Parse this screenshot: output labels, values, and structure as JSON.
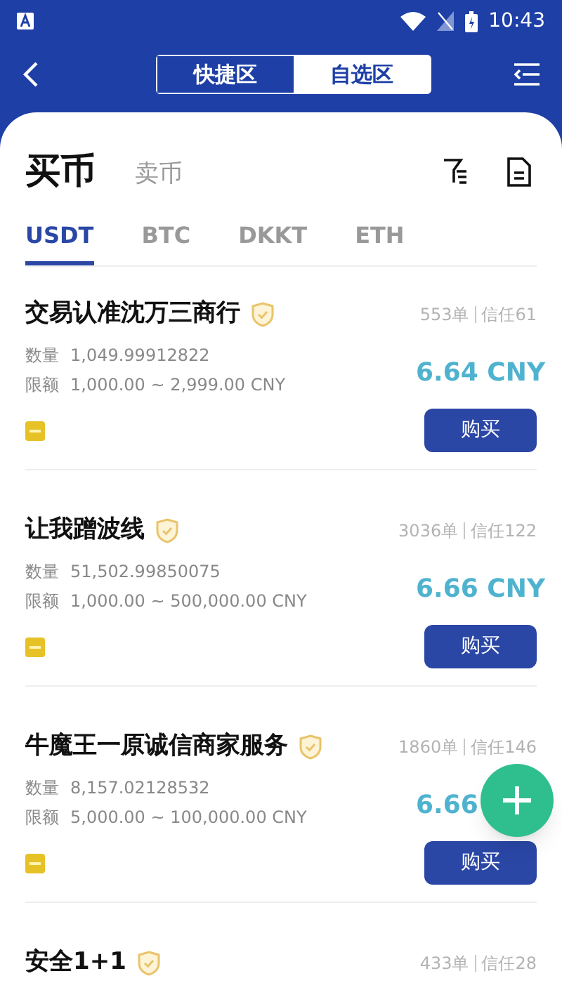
{
  "status_bar": {
    "time": "10:43"
  },
  "header": {
    "segments": [
      {
        "label": "快捷区",
        "selected": false
      },
      {
        "label": "自选区",
        "selected": true
      }
    ]
  },
  "trade_tabs": [
    {
      "label": "买币",
      "selected": true
    },
    {
      "label": "卖币",
      "selected": false
    }
  ],
  "coin_tabs": [
    {
      "label": "USDT",
      "selected": true
    },
    {
      "label": "BTC",
      "selected": false
    },
    {
      "label": "DKKT",
      "selected": false
    },
    {
      "label": "ETH",
      "selected": false
    }
  ],
  "offers": [
    {
      "merchant": "交易认准沈万三商行",
      "orders": "553单",
      "trust": "信任61",
      "quantity_label": "数量",
      "quantity": "1,049.99912822",
      "limit_label": "限额",
      "limit": "1,000.00 ~ 2,999.00 CNY",
      "price": "6.64 CNY",
      "button": "购买"
    },
    {
      "merchant": "让我蹭波线",
      "orders": "3036单",
      "trust": "信任122",
      "quantity_label": "数量",
      "quantity": "51,502.99850075",
      "limit_label": "限额",
      "limit": "1,000.00 ~ 500,000.00 CNY",
      "price": "6.66 CNY",
      "button": "购买"
    },
    {
      "merchant": "牛魔王一原诚信商家服务",
      "orders": "1860单",
      "trust": "信任146",
      "quantity_label": "数量",
      "quantity": "8,157.02128532",
      "limit_label": "限额",
      "limit": "5,000.00 ~ 100,000.00 CNY",
      "price": "6.66",
      "button": "购买"
    },
    {
      "merchant": "安全1+1",
      "orders": "433单",
      "trust": "信任28"
    }
  ]
}
